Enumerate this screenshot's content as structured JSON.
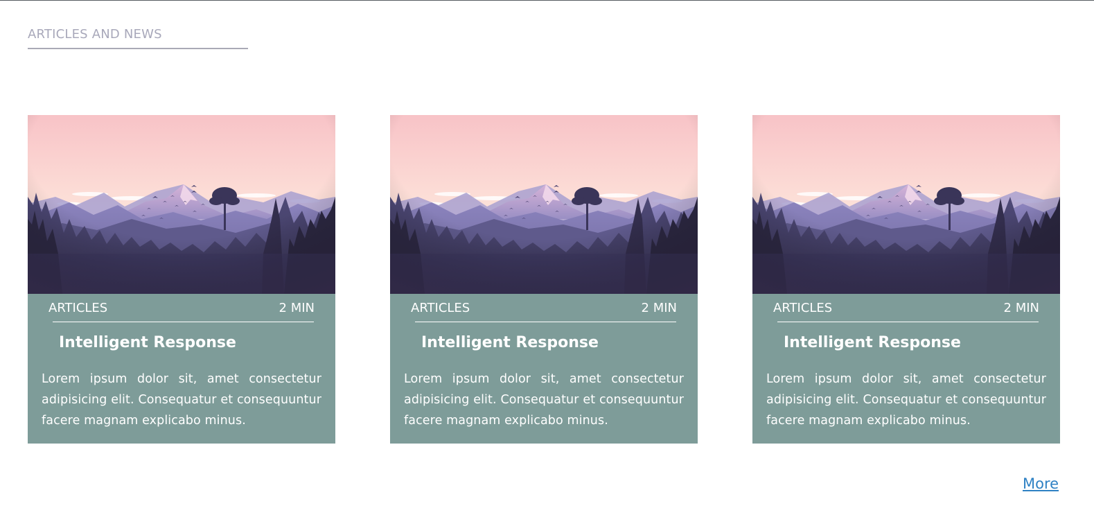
{
  "section": {
    "title": "ARTICLES AND NEWS"
  },
  "cards": [
    {
      "category": "ARTICLES",
      "read_time": "2 MIN",
      "title": "Intelligent Response",
      "body": "Lorem ipsum dolor sit, amet consectetur adipisicing elit. Consequatur et consequuntur facere magnam explicabo minus."
    },
    {
      "category": "ARTICLES",
      "read_time": "2 MIN",
      "title": "Intelligent Response",
      "body": "Lorem ipsum dolor sit, amet consectetur adipisicing elit. Consequatur et consequuntur facere magnam explicabo minus."
    },
    {
      "category": "ARTICLES",
      "read_time": "2 MIN",
      "title": "Intelligent Response",
      "body": "Lorem ipsum dolor sit, amet consectetur adipisicing elit. Consequatur et consequuntur facere magnam explicabo minus."
    }
  ],
  "footer": {
    "more_label": "More"
  },
  "colors": {
    "card_background": "#7e9c99",
    "section_title": "#a8a8ba",
    "link": "#2e81c4",
    "sky_top": "#f8c4c8",
    "sky_bottom": "#fde6dc",
    "forest_dark": "#2e2a40"
  },
  "icons": {
    "card_image": "mountain-landscape-illustration"
  }
}
